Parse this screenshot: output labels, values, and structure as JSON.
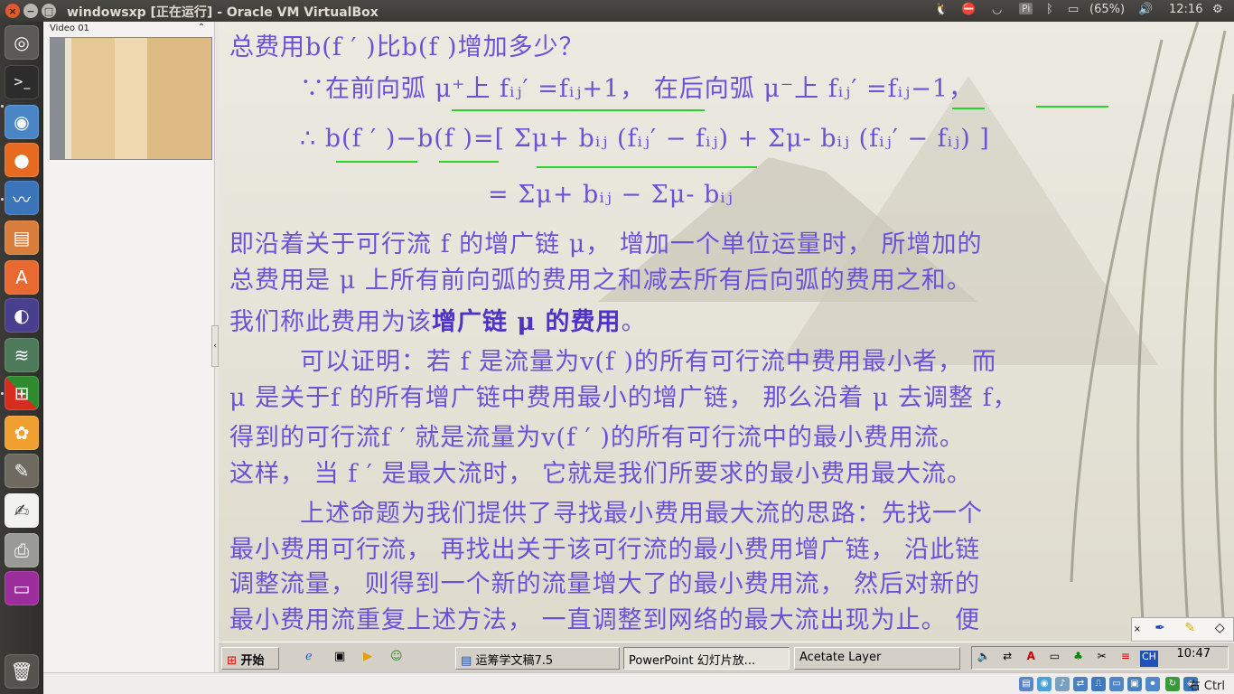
{
  "window": {
    "title": "windowsxp [正在运行] - Oracle VM VirtualBox"
  },
  "indicators": {
    "battery": "(65%)",
    "time": "12:16"
  },
  "launcher": {
    "items": [
      "ubuntu-dash",
      "terminal",
      "chromium",
      "firefox",
      "system-monitor",
      "files",
      "software-center",
      "eclipse",
      "stack",
      "windows",
      "butterfly",
      "gimp",
      "text-editor",
      "printer",
      "app",
      "trash"
    ]
  },
  "video_panel": {
    "title": "Video 01"
  },
  "slide": {
    "l1": "总费用b(f ′ )比b(f )增加多少？",
    "l2": "∵在前向弧 μ⁺上 fᵢⱼ′ =fᵢⱼ+1， 在后向弧 μ⁻上 fᵢⱼ′ =fᵢⱼ−1，",
    "l3": "∴ b(f ′ )−b(f )=[ Σμ+ bᵢⱼ (fᵢⱼ′ − fᵢⱼ) + Σμ- bᵢⱼ (fᵢⱼ′ − fᵢⱼ) ]",
    "l4": "= Σμ+ bᵢⱼ − Σμ- bᵢⱼ",
    "l5": "即沿着关于可行流 f 的增广链 μ， 增加一个单位运量时， 所增加的",
    "l6": "总费用是 μ 上所有前向弧的费用之和减去所有后向弧的费用之和。",
    "l7a": "我们称此费用为该",
    "l7b": "增广链 μ 的费用",
    "l7c": "。",
    "l8": "可以证明：若 f 是流量为v(f )的所有可行流中费用最小者，  而",
    "l9": "μ 是关于f 的所有增广链中费用最小的增广链， 那么沿着 μ 去调整 f，",
    "l10": "得到的可行流f ′ 就是流量为v(f ′ )的所有可行流中的最小费用流。",
    "l11": "这样， 当 f ′ 是最大流时， 它就是我们所要求的最小费用最大流。",
    "l12": "上述命题为我们提供了寻找最小费用最大流的思路：先找一个",
    "l13": "最小费用可行流， 再找出关于该可行流的最小费用增广链， 沿此链",
    "l14": "调整流量， 则得到一个新的流量增大了的最小费用流， 然后对新的",
    "l15": "最小费用流重复上述方法， 一直调整到网络的最大流出现为止。 便"
  },
  "xp_taskbar": {
    "start": "开始",
    "tasks": [
      "运筹学文稿7.5",
      "PowerPoint 幻灯片放...",
      "Acetate Layer"
    ],
    "clock": "10:47"
  },
  "vbox_status": {
    "host_key": "右 Ctrl"
  }
}
